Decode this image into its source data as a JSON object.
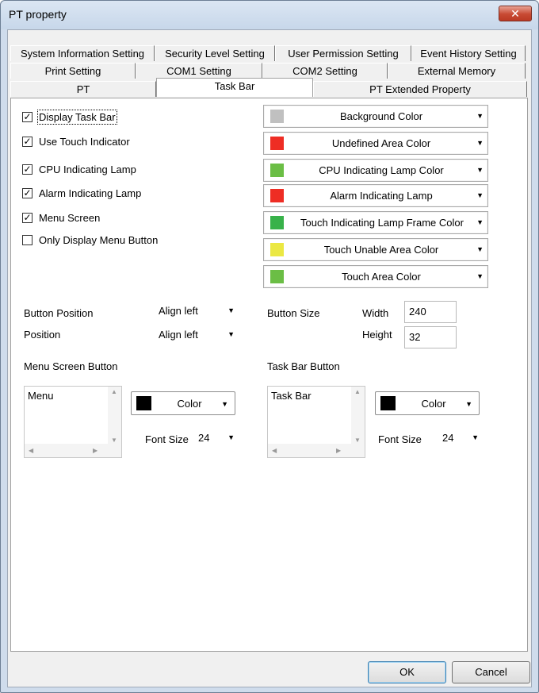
{
  "window": {
    "title": "PT property",
    "close_glyph": "✕"
  },
  "tabs": {
    "row1": [
      "System Information Setting",
      "Security Level Setting",
      "User Permission Setting",
      "Event History Setting"
    ],
    "row2": [
      "Print Setting",
      "COM1 Setting",
      "COM2 Setting",
      "External Memory"
    ],
    "row3": [
      "PT",
      "Task Bar",
      "PT Extended Property"
    ],
    "active": "Task Bar"
  },
  "checkboxes": [
    {
      "label": "Display Task Bar",
      "checked": true
    },
    {
      "label": "Use Touch Indicator",
      "checked": true
    },
    {
      "label": "CPU Indicating Lamp",
      "checked": true
    },
    {
      "label": "Alarm Indicating Lamp",
      "checked": true
    },
    {
      "label": "Menu Screen",
      "checked": true
    },
    {
      "label": "Only Display Menu Button",
      "checked": false
    }
  ],
  "check_glyph": "✓",
  "color_buttons": [
    {
      "label": "Background Color",
      "color": "#c0c0c0"
    },
    {
      "label": "Undefined Area Color",
      "color": "#ee2d24"
    },
    {
      "label": "CPU Indicating Lamp Color",
      "color": "#6bbe45"
    },
    {
      "label": "Alarm Indicating Lamp",
      "color": "#ee2d24"
    },
    {
      "label": "Touch Indicating Lamp Frame Color",
      "color": "#38b24a"
    },
    {
      "label": "Touch Unable Area Color",
      "color": "#ebe843"
    },
    {
      "label": "Touch Area Color",
      "color": "#6bbe45"
    }
  ],
  "dropdown_arrow": "▼",
  "button_position": {
    "label": "Button Position",
    "value": "Align left"
  },
  "position": {
    "label": "Position",
    "value": "Align left"
  },
  "button_size": {
    "label": "Button Size",
    "width_label": "Width",
    "width": "240",
    "height_label": "Height",
    "height": "32"
  },
  "menu_screen_button": {
    "label": "Menu Screen Button",
    "list_item": "Menu",
    "color_label": "Color",
    "color": "#000000",
    "font_size_label": "Font Size",
    "font_size": "24"
  },
  "task_bar_button": {
    "label": "Task Bar Button",
    "list_item": "Task Bar",
    "color_label": "Color",
    "color": "#000000",
    "font_size_label": "Font Size",
    "font_size": "24"
  },
  "footer": {
    "ok": "OK",
    "cancel": "Cancel"
  }
}
